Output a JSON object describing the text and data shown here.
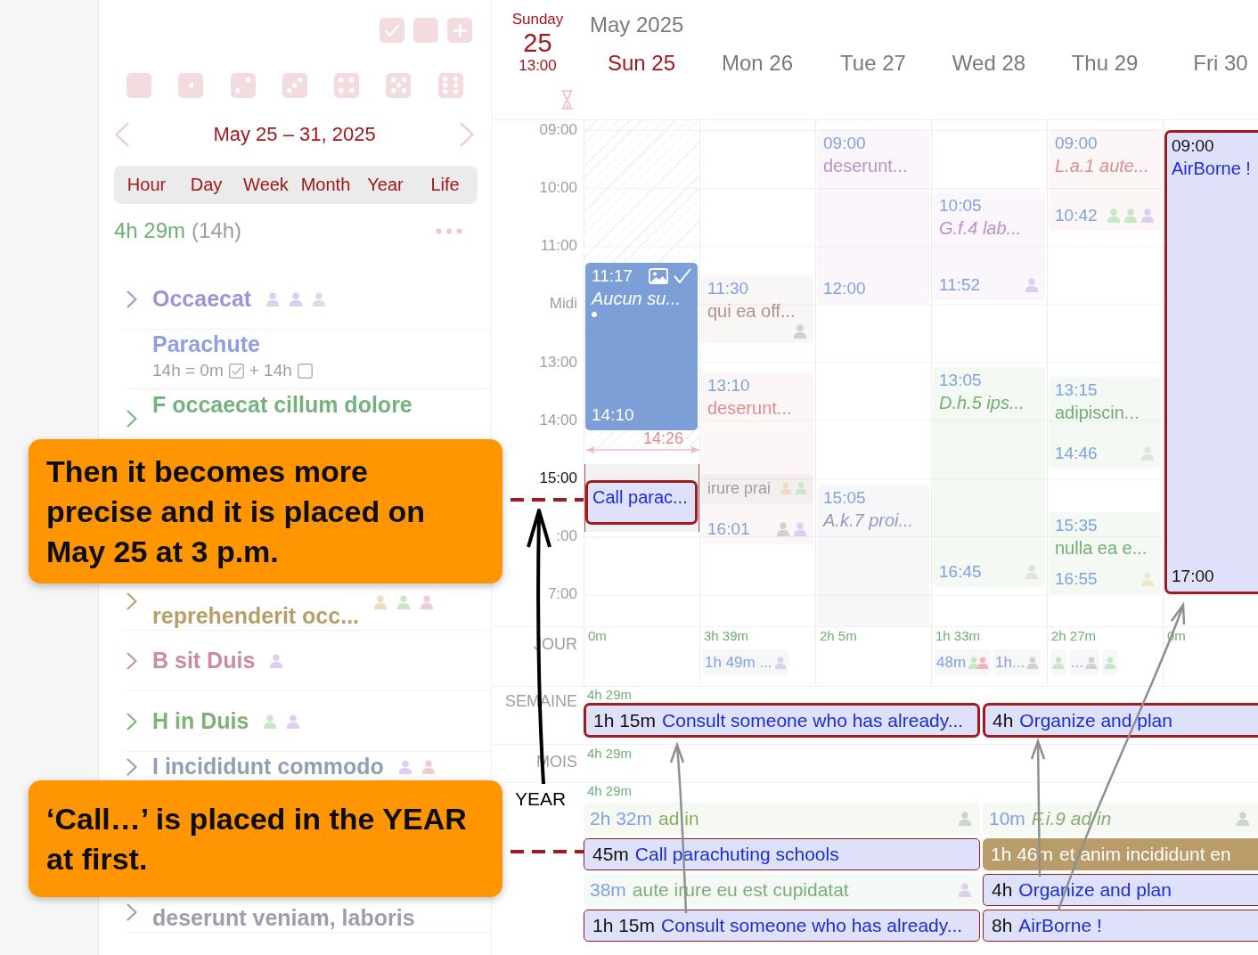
{
  "sidebar": {
    "range_title": "May 25 – 31, 2025",
    "view_tabs": [
      {
        "label": "Hour",
        "selected": false
      },
      {
        "label": "Day",
        "selected": false
      },
      {
        "label": "Week",
        "selected": false
      },
      {
        "label": "Month",
        "selected": false
      },
      {
        "label": "Year",
        "selected": false
      },
      {
        "label": "Life",
        "selected": false
      }
    ],
    "total": "4h 29m",
    "total_planned": "(14h)",
    "items": [
      {
        "kind": "group",
        "title": "Occaecat",
        "color": "#9a95d6",
        "people": [
          {
            "color": "#dccff2"
          },
          {
            "color": "#d8cdf2"
          },
          {
            "color": "#e0dbe9"
          }
        ]
      },
      {
        "kind": "task",
        "title": "Parachute",
        "color": "#8f9fe6",
        "summary": [
          {
            "text": "14h = 0m",
            "checked": true
          },
          {
            "text": "+ 14h",
            "checked": false
          }
        ]
      },
      {
        "kind": "group",
        "title": "F occaecat cillum dolore",
        "color": "#74b27e"
      },
      {
        "kind": "group",
        "title": "reprehenderit occ...",
        "color": "#b89f6a",
        "people": [
          {
            "color": "#eedcc0"
          },
          {
            "color": "#c8e6c8"
          },
          {
            "color": "#f0cdd6"
          }
        ]
      },
      {
        "kind": "group",
        "title": "B sit Duis",
        "color": "#c98d9f",
        "people": [
          {
            "color": "#dccff2"
          }
        ]
      },
      {
        "kind": "group",
        "title": "H in Duis",
        "color": "#7cb372",
        "people": [
          {
            "color": "#c8e6c8"
          },
          {
            "color": "#dccff2"
          }
        ]
      },
      {
        "kind": "group",
        "title": "I incididunt commodo",
        "color": "#919fb6",
        "people": [
          {
            "color": "#dccff2"
          },
          {
            "color": "#f0cdd6"
          }
        ]
      },
      {
        "kind": "group",
        "title": "deserunt veniam, laboris",
        "color": "#9d9dab"
      }
    ]
  },
  "calendar": {
    "today": {
      "weekday": "Sunday",
      "day": "25",
      "time": "13:00"
    },
    "month_title": "May 2025",
    "days": [
      {
        "label": "Sun 25",
        "selected": true,
        "drop_target": true,
        "marker": {
          "label": "14:26"
        },
        "events": [
          {
            "kind": "done",
            "start_label": "11:17",
            "title": "Aucun su...",
            "italic": true,
            "end_label": "14:10",
            "color": "#7d9fd8"
          },
          {
            "kind": "focus",
            "title": "Call parac..."
          }
        ]
      },
      {
        "label": "Mon 26",
        "selected": false,
        "drop_target": false,
        "events": [
          {
            "kind": "faded",
            "start_label": "11:30",
            "title": "qui ea off...",
            "color": "#b88f8f",
            "people": [
              {
                "color": "#cdd3cf"
              }
            ]
          },
          {
            "kind": "faded",
            "start_label": "13:10",
            "title": "deserunt...",
            "end_label": "16:01",
            "color": "#dc8e8e",
            "people": [
              {
                "color": "#cdd3cf"
              },
              {
                "color": "#dccff2"
              }
            ]
          },
          {
            "kind": "faded",
            "title": "irure prai",
            "color": "#9e9e9e",
            "people": [
              {
                "color": "#eedcc0"
              },
              {
                "color": "#c8e6c8"
              }
            ]
          }
        ]
      },
      {
        "label": "Tue 27",
        "selected": false,
        "drop_target": false,
        "events": [
          {
            "kind": "faded",
            "start_label": "09:00",
            "title": "deserunt...",
            "end_label": "12:00",
            "color": "#bb91c6"
          },
          {
            "kind": "faded",
            "start_label": "15:05",
            "title": "A.k.7 proi...",
            "italic": true,
            "color": "#9599c0"
          }
        ]
      },
      {
        "label": "Wed 28",
        "selected": false,
        "drop_target": false,
        "events": [
          {
            "kind": "faded",
            "start_label": "10:05",
            "title": "G.f.4 lab...",
            "italic": true,
            "end_label": "11:52",
            "color": "#bb91c6",
            "people": [
              {
                "color": "#dccff2"
              }
            ]
          },
          {
            "kind": "faded",
            "start_label": "13:05",
            "title": "D.h.5 ips...",
            "italic": true,
            "end_label": "16:45",
            "color": "#72ae72",
            "people": [
              {
                "color": "#e3e3dd"
              }
            ]
          }
        ]
      },
      {
        "label": "Thu 29",
        "selected": false,
        "drop_target": false,
        "events": [
          {
            "kind": "faded",
            "start_label": "09:00",
            "title": "L.a.1 aute...",
            "italic": true,
            "end_label": "10:42",
            "color": "#dc8e8e",
            "people": [
              {
                "color": "#c8e6c8"
              },
              {
                "color": "#c8e6c8"
              },
              {
                "color": "#dccff2"
              }
            ]
          },
          {
            "kind": "faded",
            "start_label": "13:15",
            "title": "adipiscin...",
            "end_label": "14:46",
            "color": "#72ae72",
            "people": [
              {
                "color": "#e3e3dd"
              }
            ]
          },
          {
            "kind": "faded",
            "start_label": "15:35",
            "title": "nulla ea e...",
            "end_label": "16:55",
            "color": "#72ae72",
            "people": [
              {
                "color": "#eee6d1"
              }
            ]
          }
        ]
      },
      {
        "label": "Fri 30",
        "selected": false,
        "drop_target": false,
        "events": [
          {
            "kind": "focus",
            "start_label": "09:00",
            "title": "AirBorne !",
            "end_label": "17:00"
          }
        ]
      }
    ],
    "hours": [
      {
        "label": "09:00",
        "highlighted": false
      },
      {
        "label": "10:00",
        "highlighted": false
      },
      {
        "label": "11:00",
        "highlighted": false
      },
      {
        "label": "Midi",
        "highlighted": false
      },
      {
        "label": "13:00",
        "highlighted": false
      },
      {
        "label": "14:00",
        "highlighted": false
      },
      {
        "label": "15:00",
        "highlighted": true
      },
      {
        "label": ":00",
        "highlighted": false
      },
      {
        "label": "7:00",
        "highlighted": false
      }
    ],
    "day_row": {
      "label": "JOUR",
      "days": [
        {
          "total": "0m"
        },
        {
          "total": "3h 39m",
          "chips": [
            {
              "title": "1h 49m ...",
              "people": [
                {
                  "color": "#dccff2"
                }
              ]
            }
          ]
        },
        {
          "total": "2h 5m"
        },
        {
          "total": "1h 33m",
          "chips": [
            {
              "title": "48m",
              "people": [
                {
                  "color": "#c8e6c8"
                },
                {
                  "color": "#f2b5b5"
                }
              ]
            },
            {
              "title": "1h...",
              "people": [
                {
                  "color": "#cdd3cf"
                }
              ]
            }
          ]
        },
        {
          "total": "2h 27m",
          "chips": [
            {
              "people": [
                {
                  "color": "#c8e6c8"
                }
              ]
            },
            {
              "title": "...",
              "people": [
                {
                  "color": "#cdd3cf"
                }
              ]
            },
            {
              "people": [
                {
                  "color": "#c8e6c8"
                }
              ]
            }
          ]
        },
        {
          "total": "0m"
        }
      ]
    },
    "week_row": {
      "label": "SEMAINE",
      "total": "4h 29m",
      "items": [
        {
          "kind": "focus",
          "duration": "1h 15m",
          "title": "Consult someone who has already..."
        },
        {
          "kind": "focus",
          "duration": "4h",
          "title": "Organize and plan"
        }
      ]
    },
    "month_row": {
      "label": "MOIS",
      "total": "4h 29m"
    },
    "year_row": {
      "total": "4h 29m",
      "items": [
        {
          "kind": "faded",
          "duration": "2h 32m",
          "title": "ad in",
          "color": "#86ae5f",
          "people": [
            {
              "color": "#cdd3cf"
            }
          ]
        },
        {
          "kind": "faded",
          "duration": "10m",
          "title": "F.i.9 ad in",
          "italic": true,
          "color": "#8aab74",
          "people": [
            {
              "color": "#cdd3cf"
            }
          ]
        },
        {
          "kind": "link",
          "duration": "45m",
          "title": "Call parachuting schools"
        },
        {
          "kind": "filled",
          "duration": "1h 46m",
          "title": "et anim incididunt en",
          "color": "#b99c6a"
        },
        {
          "kind": "faded",
          "duration": "38m",
          "title": "aute irure eu est cupidatat",
          "color": "#7aae7a",
          "people": [
            {
              "color": "#dccff2"
            }
          ]
        },
        {
          "kind": "link",
          "duration": "4h",
          "title": "Organize and plan"
        },
        {
          "kind": "link",
          "duration": "1h 15m",
          "title": "Consult someone who has already..."
        },
        {
          "kind": "link",
          "duration": "8h",
          "title": "AirBorne !"
        }
      ]
    }
  },
  "annotations": {
    "callouts": [
      {
        "text": "Then it becomes more precise and it is placed on May 25 at 3 p.m."
      },
      {
        "text": "‘Call…’ is placed in the YEAR at first."
      }
    ],
    "year_label": "YEAR"
  }
}
